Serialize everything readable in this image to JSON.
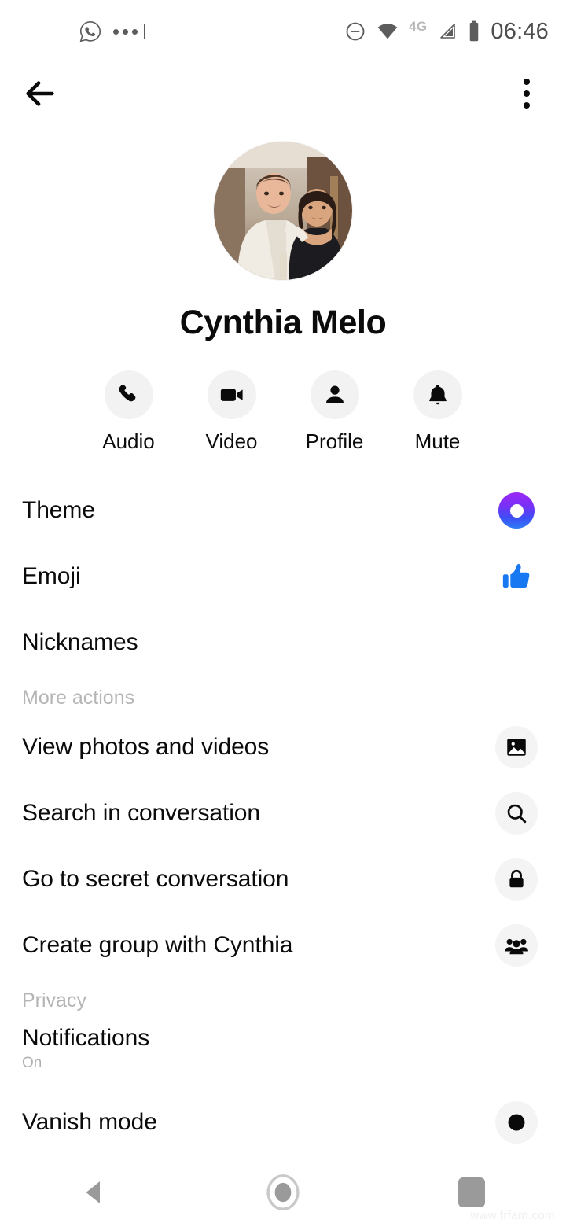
{
  "status_bar": {
    "left_icons": [
      "whatsapp-icon",
      "more-notifications-icon"
    ],
    "dnd_icon": "do-not-disturb-icon",
    "wifi_icon": "wifi-icon",
    "network_label": "4G",
    "signal_icon": "cellular-signal-icon",
    "battery_icon": "battery-icon",
    "time": "06:46"
  },
  "top_nav": {
    "back_icon": "back-arrow-icon",
    "overflow_icon": "overflow-menu-icon"
  },
  "profile": {
    "avatar_alt": "Cynthia Melo profile photo",
    "name": "Cynthia Melo"
  },
  "actions": [
    {
      "label": "Audio",
      "icon": "phone-icon"
    },
    {
      "label": "Video",
      "icon": "video-camera-icon"
    },
    {
      "label": "Profile",
      "icon": "person-icon"
    },
    {
      "label": "Mute",
      "icon": "bell-icon"
    }
  ],
  "list": [
    {
      "label": "Theme",
      "icon": "theme-gradient-ring-icon",
      "sub": ""
    },
    {
      "label": "Emoji",
      "icon": "thumbs-up-icon",
      "sub": ""
    },
    {
      "label": "Nicknames",
      "icon": "",
      "sub": ""
    }
  ],
  "sections": [
    {
      "header": "More actions",
      "items": [
        {
          "label": "View photos and videos",
          "icon": "image-icon",
          "sub": ""
        },
        {
          "label": "Search in conversation",
          "icon": "search-icon",
          "sub": ""
        },
        {
          "label": "Go to secret conversation",
          "icon": "lock-icon",
          "sub": ""
        },
        {
          "label": "Create group with Cynthia",
          "icon": "group-icon",
          "sub": ""
        }
      ]
    },
    {
      "header": "Privacy",
      "items": [
        {
          "label": "Notifications",
          "icon": "",
          "sub": "On"
        },
        {
          "label": "Vanish mode",
          "icon": "vanish-mode-icon",
          "sub": ""
        }
      ]
    }
  ],
  "system_nav": {
    "back": "nav-back-icon",
    "home": "nav-home-icon",
    "recents": "nav-recents-icon"
  },
  "watermark": "www.frfam.com",
  "colors": {
    "accent_blue": "#1778F2",
    "theme_purple": "#9B28F5",
    "theme_blue": "#2F7DF7",
    "icon_bg": "#F2F2F2",
    "muted_text": "#B5B5B5",
    "primary_text": "#0B0B0B"
  }
}
